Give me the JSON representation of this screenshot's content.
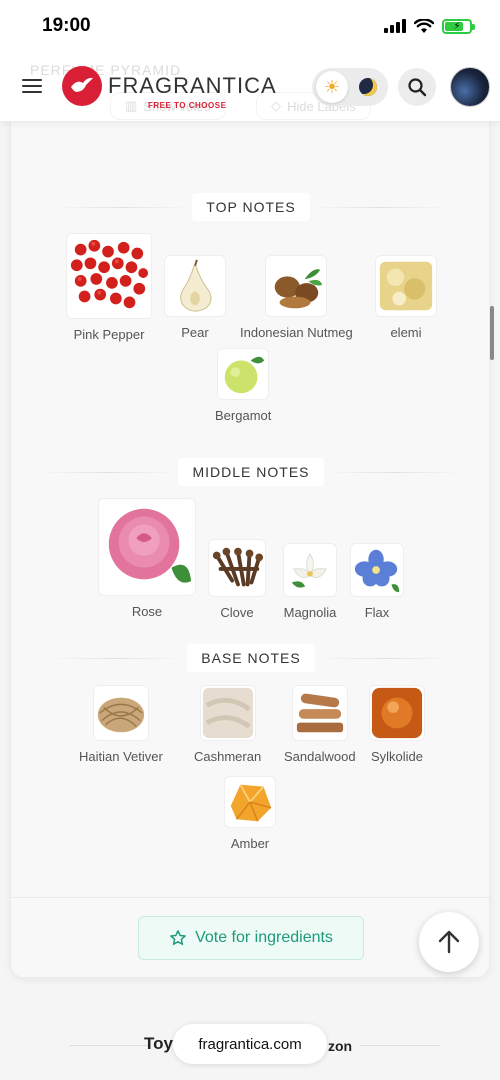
{
  "status_bar": {
    "time": "19:00"
  },
  "header": {
    "ghost_section_title": "PERFUME PYRAMID",
    "ghost_show_votes": "Show votes",
    "ghost_hide_labels": "Hide Labels",
    "logo_name": "FRAGRANTICA",
    "logo_tagline": "FREE TO CHOOSE",
    "brand_color": "#d91f36"
  },
  "sections": {
    "top": {
      "title": "TOP NOTES",
      "notes": [
        "Pink Pepper",
        "Pear",
        "Indonesian Nutmeg",
        "elemi",
        "Bergamot"
      ]
    },
    "middle": {
      "title": "MIDDLE NOTES",
      "notes": [
        "Rose",
        "Clove",
        "Magnolia",
        "Flax"
      ]
    },
    "base": {
      "title": "BASE NOTES",
      "notes": [
        "Haitian Vetiver",
        "Cashmeran",
        "Sandalwood",
        "Sylkolide",
        "Amber"
      ]
    }
  },
  "vote_button": {
    "label": "Vote for ingredients",
    "accent": "#1d9b7a"
  },
  "footer": {
    "ghost_left": "Toy",
    "ghost_right": "zon",
    "url": "fragrantica.com"
  }
}
